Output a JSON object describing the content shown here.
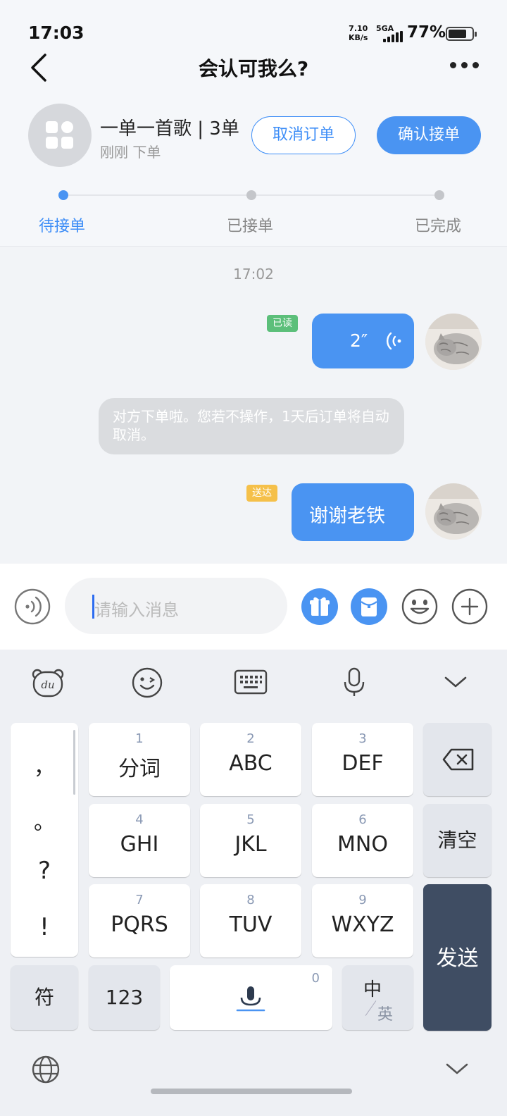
{
  "status_bar": {
    "time": "17:03",
    "net_speed_value": "7.10",
    "net_speed_unit": "KB/s",
    "network": "5GA",
    "battery_pct": "77%",
    "battery_level": 0.77
  },
  "nav": {
    "title": "会认可我么?",
    "back_icon": "chevron-left-icon",
    "more_icon": "more-horizontal-icon"
  },
  "order": {
    "name": "一单一首歌 | 3单",
    "sub": "刚刚 下单",
    "cancel_label": "取消订单",
    "confirm_label": "确认接单",
    "steps": [
      "待接单",
      "已接单",
      "已完成"
    ],
    "active_step": 0
  },
  "chat": {
    "timestamp": "17:02",
    "voice_message": {
      "badge": "已读",
      "duration": "2″"
    },
    "system_notice": "对方下单啦。您若不操作，1天后订单将自动取消。",
    "text_message": {
      "badge": "送达",
      "text": "谢谢老铁"
    }
  },
  "input": {
    "placeholder": "请输入消息"
  },
  "keyboard": {
    "toolbar": [
      "du-bear-icon",
      "emoji-icon",
      "keyboard-icon",
      "microphone-icon",
      "chevron-down-icon"
    ],
    "punctuation": [
      "，",
      "。",
      "?",
      "!"
    ],
    "keys": [
      {
        "num": "1",
        "label": "分词"
      },
      {
        "num": "2",
        "label": "ABC"
      },
      {
        "num": "3",
        "label": "DEF"
      },
      {
        "num": "4",
        "label": "GHI"
      },
      {
        "num": "5",
        "label": "JKL"
      },
      {
        "num": "6",
        "label": "MNO"
      },
      {
        "num": "7",
        "label": "PQRS"
      },
      {
        "num": "8",
        "label": "TUV"
      },
      {
        "num": "9",
        "label": "WXYZ"
      }
    ],
    "clear_label": "清空",
    "send_label": "发送",
    "symbol_label": "符",
    "num_label": "123",
    "space_num": "0",
    "lang_main": "中",
    "lang_alt": "英"
  },
  "colors": {
    "accent": "#4a94f2",
    "read_badge": "#5cbf7a",
    "sent_badge": "#f5c04a",
    "send_key": "#3f4d63"
  }
}
